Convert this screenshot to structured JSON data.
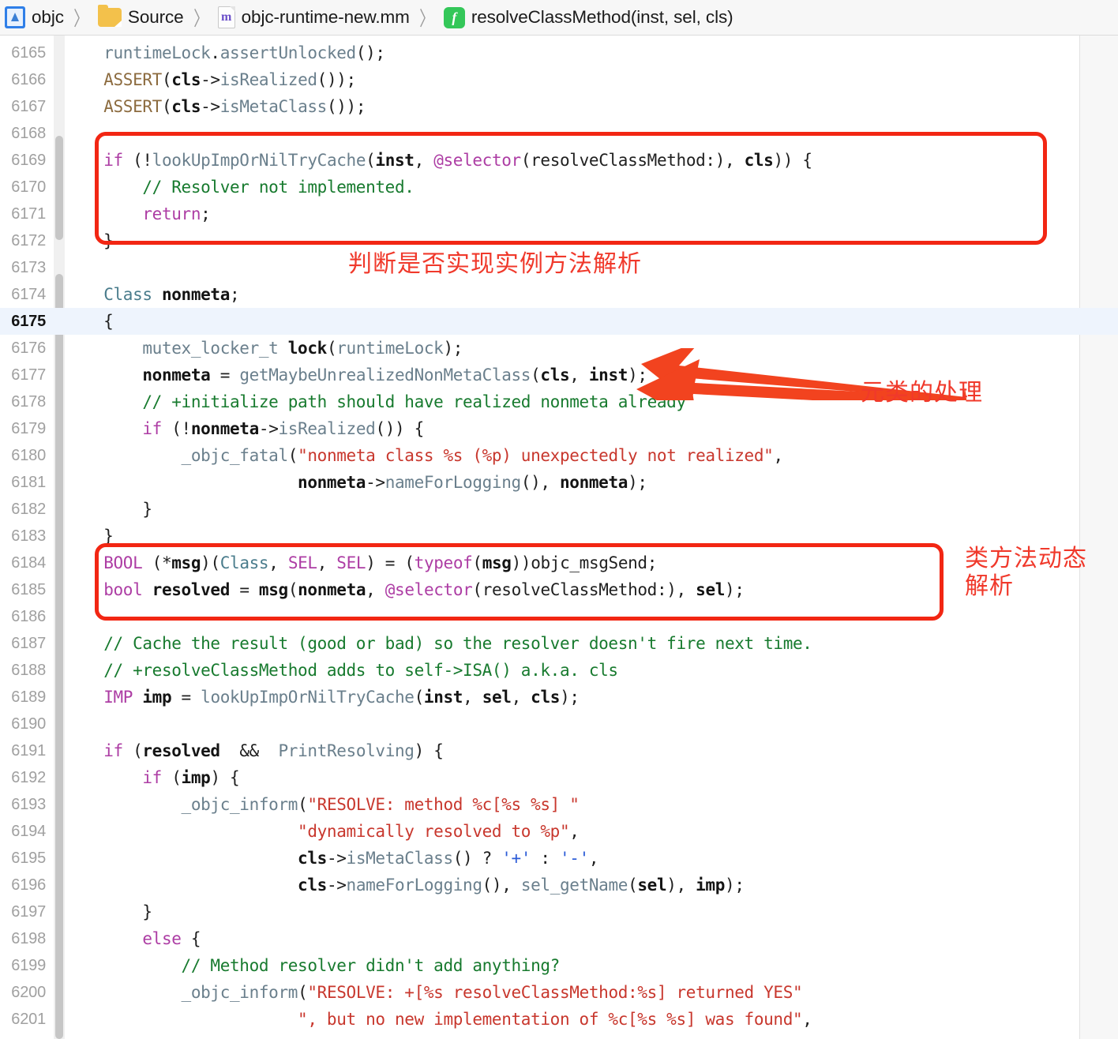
{
  "breadcrumb": {
    "items": [
      {
        "icon": "project-icon",
        "label": "objc"
      },
      {
        "icon": "folder-icon",
        "label": "Source"
      },
      {
        "icon": "objc-file-icon",
        "label": "objc-runtime-new.mm",
        "glyph": "m"
      },
      {
        "icon": "function-icon",
        "label": "resolveClassMethod(inst, sel, cls)",
        "glyph": "f"
      }
    ],
    "separator": "〉"
  },
  "editor": {
    "first_line_number": 6165,
    "current_line_number": 6175,
    "lines": [
      {
        "n": 6165,
        "tokens": [
          {
            "c": "t-pl",
            "s": "    "
          },
          {
            "c": "t-fn",
            "s": "runtimeLock"
          },
          {
            "c": "t-pl",
            "s": "."
          },
          {
            "c": "t-fn",
            "s": "assertUnlocked"
          },
          {
            "c": "t-pl",
            "s": "();"
          }
        ]
      },
      {
        "n": 6166,
        "tokens": [
          {
            "c": "t-pl",
            "s": "    "
          },
          {
            "c": "t-macro",
            "s": "ASSERT"
          },
          {
            "c": "t-pl",
            "s": "("
          },
          {
            "c": "t-var",
            "s": "cls"
          },
          {
            "c": "t-pl",
            "s": "->"
          },
          {
            "c": "t-fn",
            "s": "isRealized"
          },
          {
            "c": "t-pl",
            "s": "());"
          }
        ]
      },
      {
        "n": 6167,
        "tokens": [
          {
            "c": "t-pl",
            "s": "    "
          },
          {
            "c": "t-macro",
            "s": "ASSERT"
          },
          {
            "c": "t-pl",
            "s": "("
          },
          {
            "c": "t-var",
            "s": "cls"
          },
          {
            "c": "t-pl",
            "s": "->"
          },
          {
            "c": "t-fn",
            "s": "isMetaClass"
          },
          {
            "c": "t-pl",
            "s": "());"
          }
        ]
      },
      {
        "n": 6168,
        "tokens": []
      },
      {
        "n": 6169,
        "tokens": [
          {
            "c": "t-pl",
            "s": "    "
          },
          {
            "c": "t-kw",
            "s": "if"
          },
          {
            "c": "t-pl",
            "s": " (!"
          },
          {
            "c": "t-fn",
            "s": "lookUpImpOrNilTryCache"
          },
          {
            "c": "t-pl",
            "s": "("
          },
          {
            "c": "t-var",
            "s": "inst"
          },
          {
            "c": "t-pl",
            "s": ", "
          },
          {
            "c": "t-kw",
            "s": "@selector"
          },
          {
            "c": "t-pl",
            "s": "(resolveClassMethod:), "
          },
          {
            "c": "t-var",
            "s": "cls"
          },
          {
            "c": "t-pl",
            "s": ")) {"
          }
        ]
      },
      {
        "n": 6170,
        "tokens": [
          {
            "c": "t-pl",
            "s": "        "
          },
          {
            "c": "t-cm",
            "s": "// Resolver not implemented."
          }
        ]
      },
      {
        "n": 6171,
        "tokens": [
          {
            "c": "t-pl",
            "s": "        "
          },
          {
            "c": "t-kw",
            "s": "return"
          },
          {
            "c": "t-pl",
            "s": ";"
          }
        ]
      },
      {
        "n": 6172,
        "tokens": [
          {
            "c": "t-pl",
            "s": "    }"
          }
        ]
      },
      {
        "n": 6173,
        "tokens": []
      },
      {
        "n": 6174,
        "tokens": [
          {
            "c": "t-pl",
            "s": "    "
          },
          {
            "c": "t-type",
            "s": "Class"
          },
          {
            "c": "t-pl",
            "s": " "
          },
          {
            "c": "t-var",
            "s": "nonmeta"
          },
          {
            "c": "t-pl",
            "s": ";"
          }
        ]
      },
      {
        "n": 6175,
        "tokens": [
          {
            "c": "t-pl",
            "s": "    {"
          }
        ]
      },
      {
        "n": 6176,
        "tokens": [
          {
            "c": "t-pl",
            "s": "        "
          },
          {
            "c": "t-fn",
            "s": "mutex_locker_t"
          },
          {
            "c": "t-pl",
            "s": " "
          },
          {
            "c": "t-var",
            "s": "lock"
          },
          {
            "c": "t-pl",
            "s": "("
          },
          {
            "c": "t-fn",
            "s": "runtimeLock"
          },
          {
            "c": "t-pl",
            "s": ");"
          }
        ]
      },
      {
        "n": 6177,
        "tokens": [
          {
            "c": "t-pl",
            "s": "        "
          },
          {
            "c": "t-var",
            "s": "nonmeta"
          },
          {
            "c": "t-pl",
            "s": " = "
          },
          {
            "c": "t-fn",
            "s": "getMaybeUnrealizedNonMetaClass"
          },
          {
            "c": "t-pl",
            "s": "("
          },
          {
            "c": "t-var",
            "s": "cls"
          },
          {
            "c": "t-pl",
            "s": ", "
          },
          {
            "c": "t-var",
            "s": "inst"
          },
          {
            "c": "t-pl",
            "s": ");"
          }
        ]
      },
      {
        "n": 6178,
        "tokens": [
          {
            "c": "t-pl",
            "s": "        "
          },
          {
            "c": "t-cm",
            "s": "// +initialize path should have realized nonmeta already"
          }
        ]
      },
      {
        "n": 6179,
        "tokens": [
          {
            "c": "t-pl",
            "s": "        "
          },
          {
            "c": "t-kw",
            "s": "if"
          },
          {
            "c": "t-pl",
            "s": " (!"
          },
          {
            "c": "t-var",
            "s": "nonmeta"
          },
          {
            "c": "t-pl",
            "s": "->"
          },
          {
            "c": "t-fn",
            "s": "isRealized"
          },
          {
            "c": "t-pl",
            "s": "()) {"
          }
        ]
      },
      {
        "n": 6180,
        "tokens": [
          {
            "c": "t-pl",
            "s": "            "
          },
          {
            "c": "t-fn",
            "s": "_objc_fatal"
          },
          {
            "c": "t-pl",
            "s": "("
          },
          {
            "c": "t-str",
            "s": "\"nonmeta class %s (%p) unexpectedly not realized\""
          },
          {
            "c": "t-pl",
            "s": ","
          }
        ]
      },
      {
        "n": 6181,
        "tokens": [
          {
            "c": "t-pl",
            "s": "                        "
          },
          {
            "c": "t-var",
            "s": "nonmeta"
          },
          {
            "c": "t-pl",
            "s": "->"
          },
          {
            "c": "t-fn",
            "s": "nameForLogging"
          },
          {
            "c": "t-pl",
            "s": "(), "
          },
          {
            "c": "t-var",
            "s": "nonmeta"
          },
          {
            "c": "t-pl",
            "s": ");"
          }
        ]
      },
      {
        "n": 6182,
        "tokens": [
          {
            "c": "t-pl",
            "s": "        }"
          }
        ]
      },
      {
        "n": 6183,
        "tokens": [
          {
            "c": "t-pl",
            "s": "    }"
          }
        ]
      },
      {
        "n": 6184,
        "tokens": [
          {
            "c": "t-pl",
            "s": "    "
          },
          {
            "c": "t-kw",
            "s": "BOOL"
          },
          {
            "c": "t-pl",
            "s": " (*"
          },
          {
            "c": "t-var",
            "s": "msg"
          },
          {
            "c": "t-pl",
            "s": ")("
          },
          {
            "c": "t-type",
            "s": "Class"
          },
          {
            "c": "t-pl",
            "s": ", "
          },
          {
            "c": "t-kw",
            "s": "SEL"
          },
          {
            "c": "t-pl",
            "s": ", "
          },
          {
            "c": "t-kw",
            "s": "SEL"
          },
          {
            "c": "t-pl",
            "s": ") = ("
          },
          {
            "c": "t-kw",
            "s": "typeof"
          },
          {
            "c": "t-pl",
            "s": "("
          },
          {
            "c": "t-var",
            "s": "msg"
          },
          {
            "c": "t-pl",
            "s": "))objc_msgSend;"
          }
        ]
      },
      {
        "n": 6185,
        "tokens": [
          {
            "c": "t-pl",
            "s": "    "
          },
          {
            "c": "t-kw",
            "s": "bool"
          },
          {
            "c": "t-pl",
            "s": " "
          },
          {
            "c": "t-var",
            "s": "resolved"
          },
          {
            "c": "t-pl",
            "s": " = "
          },
          {
            "c": "t-var",
            "s": "msg"
          },
          {
            "c": "t-pl",
            "s": "("
          },
          {
            "c": "t-var",
            "s": "nonmeta"
          },
          {
            "c": "t-pl",
            "s": ", "
          },
          {
            "c": "t-kw",
            "s": "@selector"
          },
          {
            "c": "t-pl",
            "s": "(resolveClassMethod:), "
          },
          {
            "c": "t-var",
            "s": "sel"
          },
          {
            "c": "t-pl",
            "s": ");"
          }
        ]
      },
      {
        "n": 6186,
        "tokens": []
      },
      {
        "n": 6187,
        "tokens": [
          {
            "c": "t-pl",
            "s": "    "
          },
          {
            "c": "t-cm",
            "s": "// Cache the result (good or bad) so the resolver doesn't fire next time."
          }
        ]
      },
      {
        "n": 6188,
        "tokens": [
          {
            "c": "t-pl",
            "s": "    "
          },
          {
            "c": "t-cm",
            "s": "// +resolveClassMethod adds to self->ISA() a.k.a. cls"
          }
        ]
      },
      {
        "n": 6189,
        "tokens": [
          {
            "c": "t-pl",
            "s": "    "
          },
          {
            "c": "t-kw",
            "s": "IMP"
          },
          {
            "c": "t-pl",
            "s": " "
          },
          {
            "c": "t-var",
            "s": "imp"
          },
          {
            "c": "t-pl",
            "s": " = "
          },
          {
            "c": "t-fn",
            "s": "lookUpImpOrNilTryCache"
          },
          {
            "c": "t-pl",
            "s": "("
          },
          {
            "c": "t-var",
            "s": "inst"
          },
          {
            "c": "t-pl",
            "s": ", "
          },
          {
            "c": "t-var",
            "s": "sel"
          },
          {
            "c": "t-pl",
            "s": ", "
          },
          {
            "c": "t-var",
            "s": "cls"
          },
          {
            "c": "t-pl",
            "s": ");"
          }
        ]
      },
      {
        "n": 6190,
        "tokens": []
      },
      {
        "n": 6191,
        "tokens": [
          {
            "c": "t-pl",
            "s": "    "
          },
          {
            "c": "t-kw",
            "s": "if"
          },
          {
            "c": "t-pl",
            "s": " ("
          },
          {
            "c": "t-var",
            "s": "resolved"
          },
          {
            "c": "t-pl",
            "s": "  &&  "
          },
          {
            "c": "t-fn",
            "s": "PrintResolving"
          },
          {
            "c": "t-pl",
            "s": ") {"
          }
        ]
      },
      {
        "n": 6192,
        "tokens": [
          {
            "c": "t-pl",
            "s": "        "
          },
          {
            "c": "t-kw",
            "s": "if"
          },
          {
            "c": "t-pl",
            "s": " ("
          },
          {
            "c": "t-var",
            "s": "imp"
          },
          {
            "c": "t-pl",
            "s": ") {"
          }
        ]
      },
      {
        "n": 6193,
        "tokens": [
          {
            "c": "t-pl",
            "s": "            "
          },
          {
            "c": "t-fn",
            "s": "_objc_inform"
          },
          {
            "c": "t-pl",
            "s": "("
          },
          {
            "c": "t-str",
            "s": "\"RESOLVE: method %c[%s %s] \""
          }
        ]
      },
      {
        "n": 6194,
        "tokens": [
          {
            "c": "t-pl",
            "s": "                        "
          },
          {
            "c": "t-str",
            "s": "\"dynamically resolved to %p\""
          },
          {
            "c": "t-pl",
            "s": ","
          }
        ]
      },
      {
        "n": 6195,
        "tokens": [
          {
            "c": "t-pl",
            "s": "                        "
          },
          {
            "c": "t-var",
            "s": "cls"
          },
          {
            "c": "t-pl",
            "s": "->"
          },
          {
            "c": "t-fn",
            "s": "isMetaClass"
          },
          {
            "c": "t-pl",
            "s": "() ? "
          },
          {
            "c": "t-chr",
            "s": "'+'"
          },
          {
            "c": "t-pl",
            "s": " : "
          },
          {
            "c": "t-chr",
            "s": "'-'"
          },
          {
            "c": "t-pl",
            "s": ","
          }
        ]
      },
      {
        "n": 6196,
        "tokens": [
          {
            "c": "t-pl",
            "s": "                        "
          },
          {
            "c": "t-var",
            "s": "cls"
          },
          {
            "c": "t-pl",
            "s": "->"
          },
          {
            "c": "t-fn",
            "s": "nameForLogging"
          },
          {
            "c": "t-pl",
            "s": "(), "
          },
          {
            "c": "t-fn",
            "s": "sel_getName"
          },
          {
            "c": "t-pl",
            "s": "("
          },
          {
            "c": "t-var",
            "s": "sel"
          },
          {
            "c": "t-pl",
            "s": "), "
          },
          {
            "c": "t-var",
            "s": "imp"
          },
          {
            "c": "t-pl",
            "s": ");"
          }
        ]
      },
      {
        "n": 6197,
        "tokens": [
          {
            "c": "t-pl",
            "s": "        }"
          }
        ]
      },
      {
        "n": 6198,
        "tokens": [
          {
            "c": "t-pl",
            "s": "        "
          },
          {
            "c": "t-kw",
            "s": "else"
          },
          {
            "c": "t-pl",
            "s": " {"
          }
        ]
      },
      {
        "n": 6199,
        "tokens": [
          {
            "c": "t-pl",
            "s": "            "
          },
          {
            "c": "t-cm",
            "s": "// Method resolver didn't add anything?"
          }
        ]
      },
      {
        "n": 6200,
        "tokens": [
          {
            "c": "t-pl",
            "s": "            "
          },
          {
            "c": "t-fn",
            "s": "_objc_inform"
          },
          {
            "c": "t-pl",
            "s": "("
          },
          {
            "c": "t-str",
            "s": "\"RESOLVE: +[%s resolveClassMethod:%s] returned YES\""
          }
        ]
      },
      {
        "n": 6201,
        "tokens": [
          {
            "c": "t-pl",
            "s": "                        "
          },
          {
            "c": "t-str",
            "s": "\", but no new implementation of %c[%s %s] was found\""
          },
          {
            "c": "t-pl",
            "s": ","
          }
        ]
      }
    ]
  },
  "annotations": {
    "color": "#f0392b",
    "notes": [
      {
        "id": "note-instance-resolution",
        "text": "判断是否实现实例方法解析"
      },
      {
        "id": "note-metaclass-handling",
        "text": "元类的处理"
      },
      {
        "id": "note-class-method-resolution",
        "text": "类方法动态\n解析"
      }
    ],
    "boxes": [
      {
        "id": "highlight-box-resolver-check",
        "lines": "6169-6172"
      },
      {
        "id": "highlight-box-msgsend",
        "lines": "6184-6185"
      }
    ],
    "arrow": {
      "id": "pointer-arrow",
      "direction": "left",
      "color": "#f2431f"
    }
  }
}
